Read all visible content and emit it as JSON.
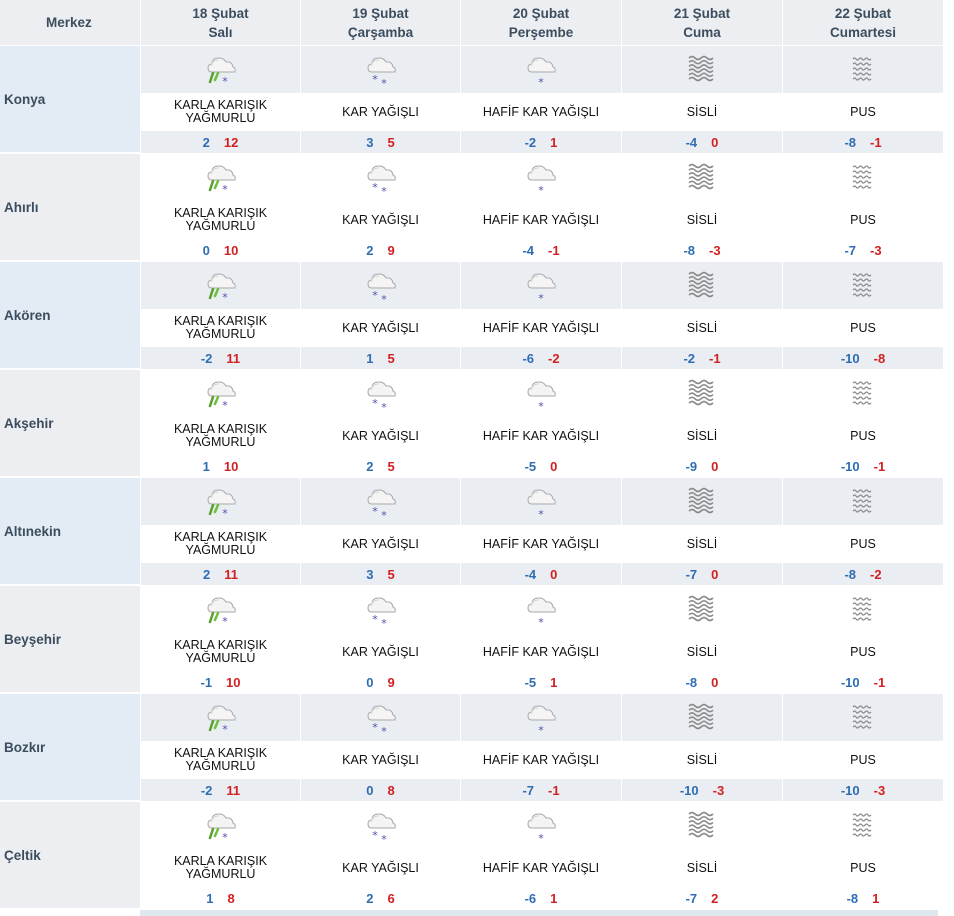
{
  "header": {
    "corner": "Merkez",
    "days": [
      {
        "date": "18 Şubat",
        "weekday": "Salı"
      },
      {
        "date": "19 Şubat",
        "weekday": "Çarşamba"
      },
      {
        "date": "20 Şubat",
        "weekday": "Perşembe"
      },
      {
        "date": "21 Şubat",
        "weekday": "Cuma"
      },
      {
        "date": "22 Şubat",
        "weekday": "Cumartesi"
      }
    ]
  },
  "colors": {
    "min_temp": "#2e6db4",
    "max_temp": "#d21f1f",
    "header_text": "#3b4d5e"
  },
  "rows": [
    {
      "city": "Konya",
      "days": [
        {
          "icon": "sleet-icon",
          "condition": "KARLA KARIŞIK YAĞMURLU",
          "min": "2",
          "max": "12"
        },
        {
          "icon": "snow-icon",
          "condition": "KAR YAĞIŞLI",
          "min": "3",
          "max": "5"
        },
        {
          "icon": "light-snow-icon",
          "condition": "HAFİF KAR YAĞIŞLI",
          "min": "-2",
          "max": "1"
        },
        {
          "icon": "fog-icon",
          "condition": "SİSLİ",
          "min": "-4",
          "max": "0"
        },
        {
          "icon": "haze-icon",
          "condition": "PUS",
          "min": "-8",
          "max": "-1"
        }
      ]
    },
    {
      "city": "Ahırlı",
      "days": [
        {
          "icon": "sleet-icon",
          "condition": "KARLA KARIŞIK YAĞMURLU",
          "min": "0",
          "max": "10"
        },
        {
          "icon": "snow-icon",
          "condition": "KAR YAĞIŞLI",
          "min": "2",
          "max": "9"
        },
        {
          "icon": "light-snow-icon",
          "condition": "HAFİF KAR YAĞIŞLI",
          "min": "-4",
          "max": "-1"
        },
        {
          "icon": "fog-icon",
          "condition": "SİSLİ",
          "min": "-8",
          "max": "-3"
        },
        {
          "icon": "haze-icon",
          "condition": "PUS",
          "min": "-7",
          "max": "-3"
        }
      ]
    },
    {
      "city": "Akören",
      "days": [
        {
          "icon": "sleet-icon",
          "condition": "KARLA KARIŞIK YAĞMURLU",
          "min": "-2",
          "max": "11"
        },
        {
          "icon": "snow-icon",
          "condition": "KAR YAĞIŞLI",
          "min": "1",
          "max": "5"
        },
        {
          "icon": "light-snow-icon",
          "condition": "HAFİF KAR YAĞIŞLI",
          "min": "-6",
          "max": "-2"
        },
        {
          "icon": "fog-icon",
          "condition": "SİSLİ",
          "min": "-2",
          "max": "-1"
        },
        {
          "icon": "haze-icon",
          "condition": "PUS",
          "min": "-10",
          "max": "-8"
        }
      ]
    },
    {
      "city": "Akşehir",
      "days": [
        {
          "icon": "sleet-icon",
          "condition": "KARLA KARIŞIK YAĞMURLU",
          "min": "1",
          "max": "10"
        },
        {
          "icon": "snow-icon",
          "condition": "KAR YAĞIŞLI",
          "min": "2",
          "max": "5"
        },
        {
          "icon": "light-snow-icon",
          "condition": "HAFİF KAR YAĞIŞLI",
          "min": "-5",
          "max": "0"
        },
        {
          "icon": "fog-icon",
          "condition": "SİSLİ",
          "min": "-9",
          "max": "0"
        },
        {
          "icon": "haze-icon",
          "condition": "PUS",
          "min": "-10",
          "max": "-1"
        }
      ]
    },
    {
      "city": "Altınekin",
      "days": [
        {
          "icon": "sleet-icon",
          "condition": "KARLA KARIŞIK YAĞMURLU",
          "min": "2",
          "max": "11"
        },
        {
          "icon": "snow-icon",
          "condition": "KAR YAĞIŞLI",
          "min": "3",
          "max": "5"
        },
        {
          "icon": "light-snow-icon",
          "condition": "HAFİF KAR YAĞIŞLI",
          "min": "-4",
          "max": "0"
        },
        {
          "icon": "fog-icon",
          "condition": "SİSLİ",
          "min": "-7",
          "max": "0"
        },
        {
          "icon": "haze-icon",
          "condition": "PUS",
          "min": "-8",
          "max": "-2"
        }
      ]
    },
    {
      "city": "Beyşehir",
      "days": [
        {
          "icon": "sleet-icon",
          "condition": "KARLA KARIŞIK YAĞMURLU",
          "min": "-1",
          "max": "10"
        },
        {
          "icon": "snow-icon",
          "condition": "KAR YAĞIŞLI",
          "min": "0",
          "max": "9"
        },
        {
          "icon": "light-snow-icon",
          "condition": "HAFİF KAR YAĞIŞLI",
          "min": "-5",
          "max": "1"
        },
        {
          "icon": "fog-icon",
          "condition": "SİSLİ",
          "min": "-8",
          "max": "0"
        },
        {
          "icon": "haze-icon",
          "condition": "PUS",
          "min": "-10",
          "max": "-1"
        }
      ]
    },
    {
      "city": "Bozkır",
      "days": [
        {
          "icon": "sleet-icon",
          "condition": "KARLA KARIŞIK YAĞMURLU",
          "min": "-2",
          "max": "11"
        },
        {
          "icon": "snow-icon",
          "condition": "KAR YAĞIŞLI",
          "min": "0",
          "max": "8"
        },
        {
          "icon": "light-snow-icon",
          "condition": "HAFİF KAR YAĞIŞLI",
          "min": "-7",
          "max": "-1"
        },
        {
          "icon": "fog-icon",
          "condition": "SİSLİ",
          "min": "-10",
          "max": "-3"
        },
        {
          "icon": "haze-icon",
          "condition": "PUS",
          "min": "-10",
          "max": "-3"
        }
      ]
    },
    {
      "city": "Çeltik",
      "days": [
        {
          "icon": "sleet-icon",
          "condition": "KARLA KARIŞIK YAĞMURLU",
          "min": "1",
          "max": "8"
        },
        {
          "icon": "snow-icon",
          "condition": "KAR YAĞIŞLI",
          "min": "2",
          "max": "6"
        },
        {
          "icon": "light-snow-icon",
          "condition": "HAFİF KAR YAĞIŞLI",
          "min": "-6",
          "max": "1"
        },
        {
          "icon": "fog-icon",
          "condition": "SİSLİ",
          "min": "-7",
          "max": "2"
        },
        {
          "icon": "haze-icon",
          "condition": "PUS",
          "min": "-8",
          "max": "1"
        }
      ]
    }
  ]
}
